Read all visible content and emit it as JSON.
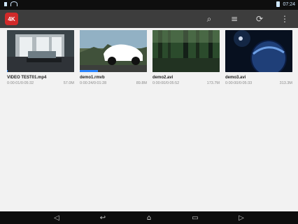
{
  "statusbar": {
    "time": "07:24"
  },
  "toolbar": {
    "logo_text": "4K",
    "icons": [
      "search-icon",
      "sort-icon",
      "refresh-icon",
      "more-icon"
    ]
  },
  "videos": [
    {
      "title": "VIDEO TEST01.mp4",
      "position": "0:00:01/0:05:32",
      "size": "57.0M",
      "progress": 0.003,
      "colors": [
        "#6e7c84",
        "#cfd7db",
        "#2f3338"
      ]
    },
    {
      "title": "demo1.rmvb",
      "position": "0:00:24/0:01:28",
      "size": "89.8M",
      "progress": 0.27,
      "colors": [
        "#92b1c4",
        "#ffffff",
        "#5a6a4d"
      ]
    },
    {
      "title": "demo2.avi",
      "position": "0:00:00/0:05:52",
      "size": "173.7M",
      "progress": 0.0,
      "colors": [
        "#2b4b2c",
        "#6f8b64",
        "#142018"
      ]
    },
    {
      "title": "demo3.avi",
      "position": "0:00:00/0:05:33",
      "size": "313.3M",
      "progress": 0.0,
      "colors": [
        "#0b1b3e",
        "#3c6ab6",
        "#07101f"
      ]
    }
  ],
  "navbar": {
    "icons": [
      "volume-down-icon",
      "back-icon",
      "home-icon",
      "recents-icon",
      "volume-up-icon"
    ]
  },
  "accent": "#2a84ff"
}
